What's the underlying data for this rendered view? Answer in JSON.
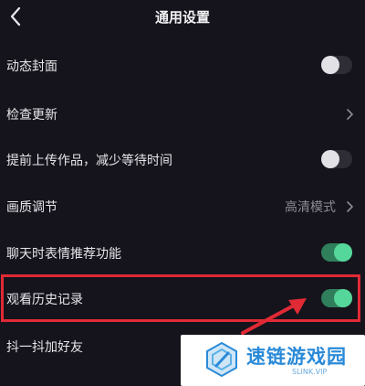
{
  "header": {
    "title": "通用设置"
  },
  "settings": [
    {
      "label": "动态封面",
      "control": "toggle",
      "state": "off"
    },
    {
      "label": "检查更新",
      "control": "chevron"
    },
    {
      "label": "提前上传作品，减少等待时间",
      "control": "toggle",
      "state": "off"
    },
    {
      "label": "画质调节",
      "control": "chevron",
      "value": "高清模式"
    },
    {
      "label": "聊天时表情推荐功能",
      "control": "toggle",
      "state": "on"
    },
    {
      "label": "观看历史记录",
      "control": "toggle",
      "state": "on"
    },
    {
      "label": "抖一抖加好友",
      "control": "toggle",
      "state": "off"
    }
  ],
  "watermark": {
    "text": "速链游戏园",
    "sub": "SLINK.VIP"
  },
  "colors": {
    "background": "#15141c",
    "toggle_on": "#55d69a",
    "highlight": "#e02a35"
  }
}
